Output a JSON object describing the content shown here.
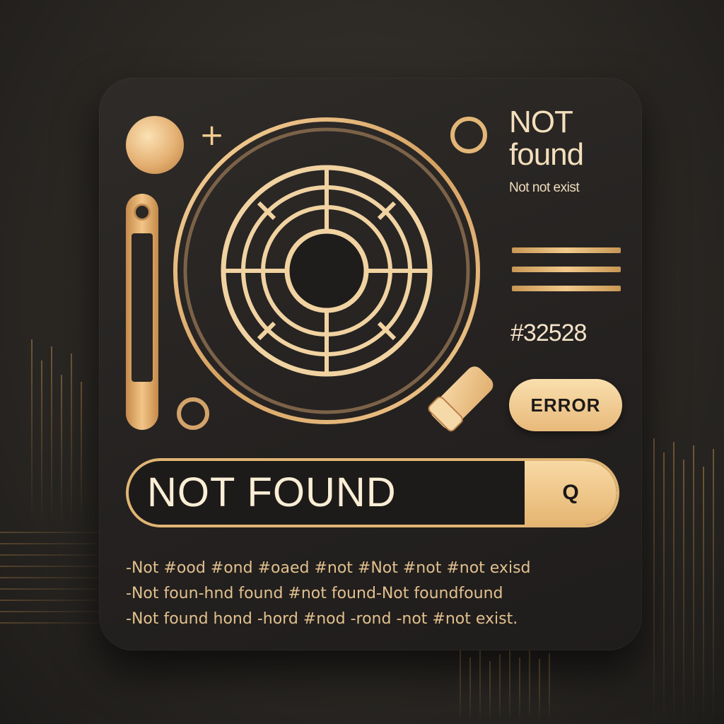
{
  "header": {
    "title_line1": "NOT",
    "title_line2": "found",
    "subtitle": "Not not exist"
  },
  "code": {
    "hash": "#32528"
  },
  "badge": {
    "label": "ERROR"
  },
  "search": {
    "value": "NOT FOUND",
    "button_icon": "search-icon",
    "button_glyph": "Q"
  },
  "error_lines": [
    "-Not #ood #ond #oaed #not #Not #not #not exisd",
    "-Not foun-hnd found #not found-Not foundfound",
    "-Not found hond -hord #nod -rond -not #not exist."
  ],
  "colors": {
    "gold": "#e3b677",
    "gold_light": "#f8d9a4",
    "card_bg": "#242120",
    "page_bg": "#2b2824"
  },
  "icons": {
    "magnifier": "magnifier-icon",
    "orb": "orb-icon",
    "plus": "plus-icon",
    "ring": "ring-icon",
    "menu": "menu-lines-icon",
    "slider": "slider-icon"
  }
}
